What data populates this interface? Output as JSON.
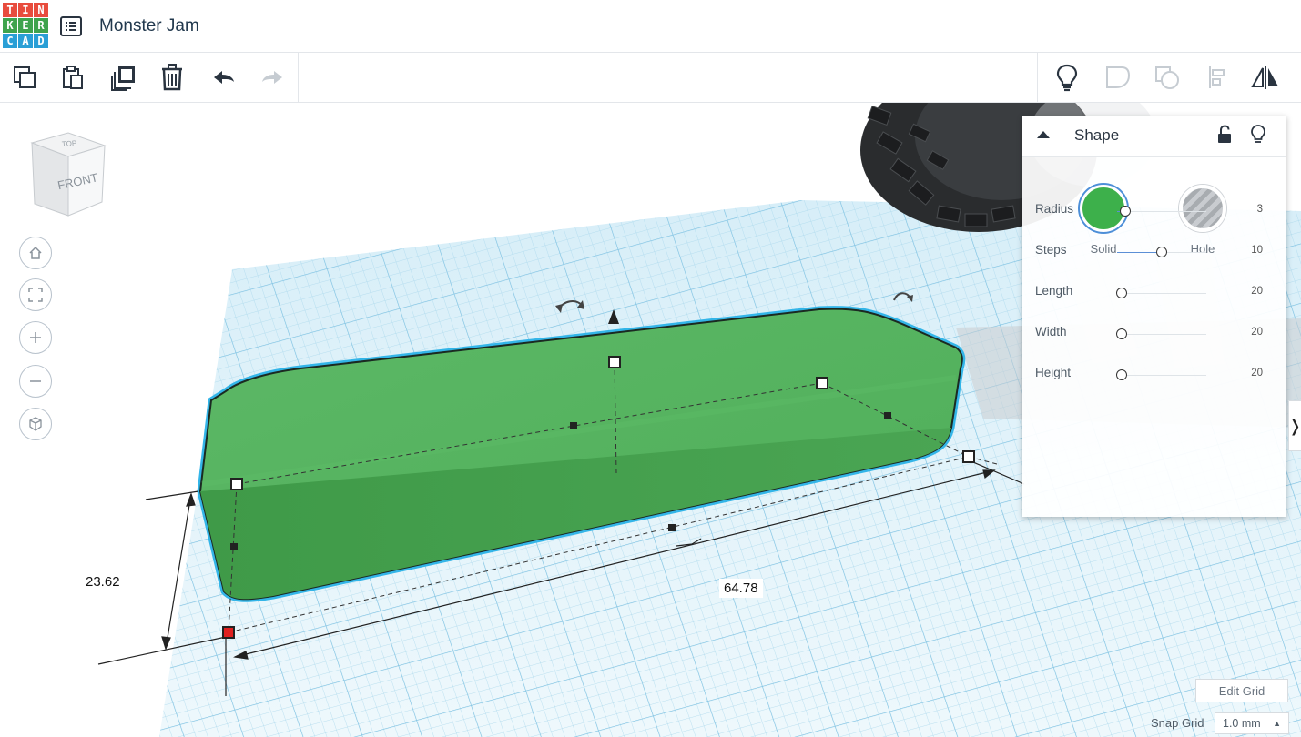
{
  "app": {
    "logo_letters": [
      "T",
      "I",
      "N",
      "K",
      "E",
      "R",
      "C",
      "A",
      "D"
    ],
    "logo_colors": [
      "#e84c3d",
      "#e84c3d",
      "#e84c3d",
      "#3fa34d",
      "#3fa34d",
      "#3fa34d",
      "#2a9fd6",
      "#2a9fd6",
      "#2a9fd6"
    ],
    "title": "Monster Jam",
    "list_icon": "list-icon"
  },
  "toolbar": {
    "left_tools": [
      {
        "name": "copy-icon"
      },
      {
        "name": "paste-icon"
      },
      {
        "name": "duplicate-icon"
      },
      {
        "name": "delete-icon"
      },
      {
        "name": "undo-icon"
      },
      {
        "name": "redo-icon"
      }
    ],
    "right_tools": [
      {
        "name": "lightbulb-icon"
      },
      {
        "name": "group-icon"
      },
      {
        "name": "ungroup-icon"
      },
      {
        "name": "align-icon"
      },
      {
        "name": "mirror-icon"
      }
    ]
  },
  "viewcube": {
    "face_label": "FRONT",
    "top_label": "TOP"
  },
  "nav_controls": [
    "home-icon",
    "fit-view-icon",
    "zoom-in-icon",
    "zoom-out-icon",
    "ortho-view-icon"
  ],
  "dimensions": {
    "height": "23.62",
    "length": "64.78"
  },
  "shape_panel": {
    "title": "Shape",
    "solid_label": "Solid",
    "hole_label": "Hole",
    "solid_color": "#3db04b",
    "properties": [
      {
        "name": "Radius",
        "value": "3",
        "fraction": 0.04
      },
      {
        "name": "Steps",
        "value": "10",
        "fraction": 0.45
      },
      {
        "name": "Length",
        "value": "20",
        "fraction": 0.0
      },
      {
        "name": "Width",
        "value": "20",
        "fraction": 0.0
      },
      {
        "name": "Height",
        "value": "20",
        "fraction": 0.0
      }
    ]
  },
  "grid_controls": {
    "edit_grid": "Edit Grid",
    "snap_grid_label": "Snap Grid",
    "snap_grid_value": "1.0 mm",
    "snap_caret": "▲"
  },
  "colors": {
    "shape_green": "#4fb05a",
    "selection_outline": "#32b4e6",
    "grid_blue": "#bfe3f2",
    "accent": "#2f7fd0"
  }
}
